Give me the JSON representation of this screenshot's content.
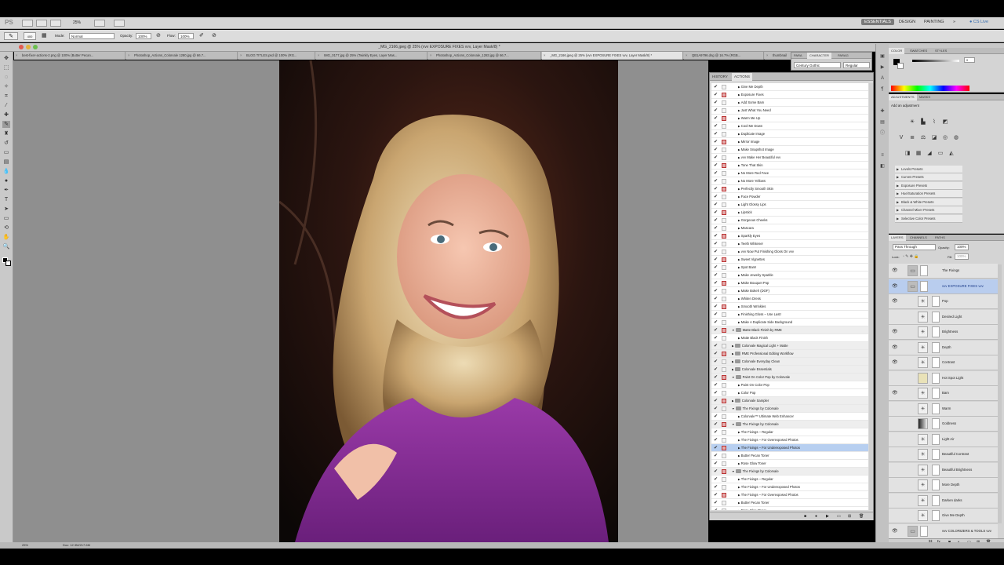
{
  "app": {
    "logo": "PS",
    "zoom": "25%"
  },
  "workspaces": {
    "essentials": "ESSENTIALS",
    "design": "DESIGN",
    "painting": "PAINTING",
    "more": "»",
    "cslive": "CS Live"
  },
  "options": {
    "mode_label": "Mode:",
    "mode_value": "Normal",
    "opacity_label": "Opacity:",
    "opacity_value": "100%",
    "flow_label": "Flow:",
    "flow_value": "100%",
    "brush_size": "400"
  },
  "document": {
    "title": "_MG_2166.jpeg @ 25% (vvv EXPOSURE FIXES vvv, Layer Mask/8) *"
  },
  "tabs": [
    "best-fixer-actions-2.png @ 100% (Butter Pecan...",
    "Photoshop_Actions_Colorvale 1280.jpg @ 66.7...",
    "BLOG TITLES.psd @ 100% (RG...",
    "IMG_0177.jpg @ 25% (Twinkly Eyes, Layer Mas...",
    "Photoshop_Actions_Colorvale_1283.jpg @ 66.7...",
    "_MG_2166.jpeg @ 25% (vvv EXPOSURE FIXES vvv, Layer Mask/8) *",
    "QB1A9796.dng @ 16.7% (RGB...",
    "thumbnail"
  ],
  "status": {
    "zoom": "25%",
    "doc": "Doc: 12.3M/217.6M"
  },
  "character_panel": {
    "tabs": [
      "PARA",
      "CHARACTER",
      "PARAG"
    ],
    "font": "Century Gothic",
    "style": "Regular"
  },
  "actions_panel": {
    "tabs": [
      "HISTORY",
      "ACTIONS"
    ],
    "rows": [
      {
        "label": "Give Me Depth",
        "indent": 2
      },
      {
        "label": "Exposure Fixes",
        "indent": 2
      },
      {
        "label": "Add Some Bam",
        "indent": 2
      },
      {
        "label": "Just What You Need",
        "indent": 2
      },
      {
        "label": "Warm Me Up",
        "indent": 2
      },
      {
        "label": "Cool Me Down",
        "indent": 2
      },
      {
        "label": "Duplicate Image",
        "indent": 2
      },
      {
        "label": "Mirror Image",
        "indent": 2
      },
      {
        "label": "Make Snapshot Image",
        "indent": 2
      },
      {
        "label": "vvv Make Her Beautiful vvv",
        "indent": 2
      },
      {
        "label": "Tone That Skin",
        "indent": 2
      },
      {
        "label": "No More Red Face",
        "indent": 2
      },
      {
        "label": "No More Yellows",
        "indent": 2
      },
      {
        "label": "Perfectly Smooth Skin",
        "indent": 2
      },
      {
        "label": "Face Powder",
        "indent": 2
      },
      {
        "label": "Light Glossy Lips",
        "indent": 2
      },
      {
        "label": "Lipstick",
        "indent": 2
      },
      {
        "label": "Gorgeous Cheeks",
        "indent": 2
      },
      {
        "label": "Mascara",
        "indent": 2
      },
      {
        "label": "Sparkly Eyes",
        "indent": 2
      },
      {
        "label": "Teeth Whitener",
        "indent": 2
      },
      {
        "label": "vvv Now Put Finishing Gloss On vvv",
        "indent": 2
      },
      {
        "label": "Sweet Vignettes",
        "indent": 2
      },
      {
        "label": "Spot Bam!",
        "indent": 2
      },
      {
        "label": "Make Jewelry Sparkle",
        "indent": 2
      },
      {
        "label": "Make Bouquet Pop",
        "indent": 2
      },
      {
        "label": "Make Bokeh (DOF)",
        "indent": 2
      },
      {
        "label": "Whiten Dress",
        "indent": 2
      },
      {
        "label": "Smooth Wrinkles",
        "indent": 2
      },
      {
        "label": "Finishing Gloss – Use Last!",
        "indent": 2
      },
      {
        "label": "Make A Duplicate Side Background",
        "indent": 2
      },
      {
        "label": "Matte Black Finish by RME",
        "indent": 1,
        "set": true,
        "open": true
      },
      {
        "label": "Matte Black Finish",
        "indent": 2
      },
      {
        "label": "Colorvale Magical Light + Matte",
        "indent": 1,
        "set": true
      },
      {
        "label": "RME Professional Editing Workflow",
        "indent": 1,
        "set": true
      },
      {
        "label": "Colorvale Everyday Clean",
        "indent": 1,
        "set": true
      },
      {
        "label": "Colorvale Essentials",
        "indent": 1,
        "set": true
      },
      {
        "label": "Paint On Color Pop by Colorvale",
        "indent": 1,
        "set": true,
        "open": true
      },
      {
        "label": "Paint On Color Pop",
        "indent": 2
      },
      {
        "label": "Color Pop",
        "indent": 2
      },
      {
        "label": "Colorvale Sampler",
        "indent": 1,
        "set": true
      },
      {
        "label": "The Fixings by Colorvale",
        "indent": 1,
        "set": true,
        "open": true
      },
      {
        "label": "Colorvale™ Ultimate Web Enhancer",
        "indent": 2
      },
      {
        "label": "The Fixings by Colorvale",
        "indent": 1,
        "set": true,
        "open": true
      },
      {
        "label": "The Fixings – Regular",
        "indent": 2
      },
      {
        "label": "The Fixings – For Overexposed Photos",
        "indent": 2
      },
      {
        "label": "The Fixings – For Underexposed Photos",
        "indent": 2,
        "selected": true
      },
      {
        "label": "Butter Pecan Toner",
        "indent": 2
      },
      {
        "label": "Rose Glow Toner",
        "indent": 2
      },
      {
        "label": "The Fixings by Colorvale",
        "indent": 1,
        "set": true,
        "open": true
      },
      {
        "label": "The Fixings – Regular",
        "indent": 2
      },
      {
        "label": "The Fixings – For Underexposed Photos",
        "indent": 2
      },
      {
        "label": "The Fixings – For Overexposed Photos",
        "indent": 2
      },
      {
        "label": "Butter Pecan Toner",
        "indent": 2
      },
      {
        "label": "Rose Glow Toner",
        "indent": 2
      }
    ]
  },
  "color_panel": {
    "tabs": [
      "COLOR",
      "SWATCHES",
      "STYLES"
    ],
    "value": "0"
  },
  "adjustments_panel": {
    "tabs": [
      "ADJUSTMENTS",
      "MASKS"
    ],
    "hint": "Add an adjustment",
    "presets": [
      "Levels Presets",
      "Curves Presets",
      "Exposure Presets",
      "Hue/Saturation Presets",
      "Black & White Presets",
      "Channel Mixer Presets",
      "Selective Color Presets"
    ]
  },
  "layers_panel": {
    "tabs": [
      "LAYERS",
      "CHANNELS",
      "PATHS"
    ],
    "blend": "Pass Through",
    "opacity_label": "Opacity:",
    "opacity": "100%",
    "lock_label": "Lock:",
    "fill_label": "Fill:",
    "fill": "100%",
    "layers": [
      {
        "name": "The Fixings",
        "visible": true,
        "type": "group"
      },
      {
        "name": "vvv EXPOSURE FIXES vvv",
        "visible": true,
        "type": "group",
        "selected": true
      },
      {
        "name": "Pop",
        "visible": true,
        "type": "adj"
      },
      {
        "name": "Desired Light",
        "visible": false,
        "type": "adj"
      },
      {
        "name": "Brightness",
        "visible": true,
        "type": "adj"
      },
      {
        "name": "Depth",
        "visible": true,
        "type": "adj"
      },
      {
        "name": "Contrast",
        "visible": true,
        "type": "adj"
      },
      {
        "name": "Hot Spot Light",
        "visible": false,
        "type": "fill"
      },
      {
        "name": "Bam",
        "visible": true,
        "type": "adj"
      },
      {
        "name": "Warm",
        "visible": false,
        "type": "adj"
      },
      {
        "name": "Goldness",
        "visible": false,
        "type": "grad"
      },
      {
        "name": "Light Air",
        "visible": false,
        "type": "adj"
      },
      {
        "name": "Beautiful Contrast",
        "visible": false,
        "type": "adj"
      },
      {
        "name": "Beautiful Brightness",
        "visible": false,
        "type": "adj"
      },
      {
        "name": "More Depth",
        "visible": false,
        "type": "adj"
      },
      {
        "name": "Darken darks",
        "visible": false,
        "type": "adj"
      },
      {
        "name": "Give Me Depth",
        "visible": false,
        "type": "adj"
      },
      {
        "name": "vvv COLORIZERS & TOOLS vvv",
        "visible": true,
        "type": "group"
      }
    ]
  }
}
